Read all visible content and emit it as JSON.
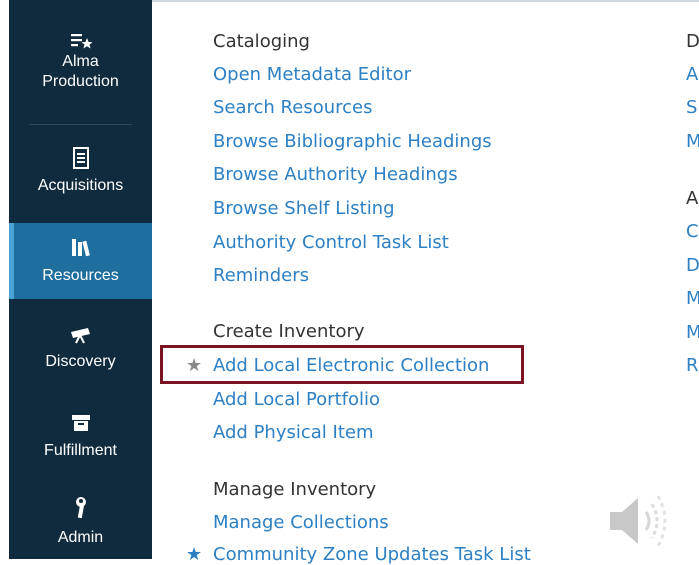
{
  "sidebar": {
    "items": [
      {
        "label1": "Alma",
        "label2": "Production",
        "icon": "star-list-icon"
      },
      {
        "label": "Acquisitions",
        "icon": "ledger-icon"
      },
      {
        "label": "Resources",
        "icon": "books-icon",
        "active": true
      },
      {
        "label": "Discovery",
        "icon": "telescope-icon"
      },
      {
        "label": "Fulfillment",
        "icon": "archive-box-icon"
      },
      {
        "label": "Admin",
        "icon": "wrench-icon"
      }
    ]
  },
  "menu": {
    "cataloging": {
      "title": "Cataloging",
      "links": [
        "Open Metadata Editor",
        "Search Resources",
        "Browse Bibliographic Headings",
        "Browse Authority Headings",
        "Browse Shelf Listing",
        "Authority Control Task List",
        "Reminders"
      ]
    },
    "create_inventory": {
      "title": "Create Inventory",
      "links": [
        "Add Local Electronic Collection",
        "Add Local Portfolio",
        "Add Physical Item"
      ],
      "star": "★"
    },
    "manage_inventory": {
      "title": "Manage Inventory",
      "links": [
        "Manage Collections",
        "Community Zone Updates Task List"
      ],
      "star": "★"
    },
    "column2": {
      "title1": "D",
      "links1": [
        "A",
        "S",
        "M"
      ],
      "title2": "A",
      "links2": [
        "C",
        "D",
        "M",
        "M",
        "R"
      ]
    }
  },
  "colors": {
    "sidebar_bg": "#0f2b3d",
    "active_bg": "#1f6f9e",
    "link": "#2d80c4",
    "highlight_border": "#7a1322"
  }
}
